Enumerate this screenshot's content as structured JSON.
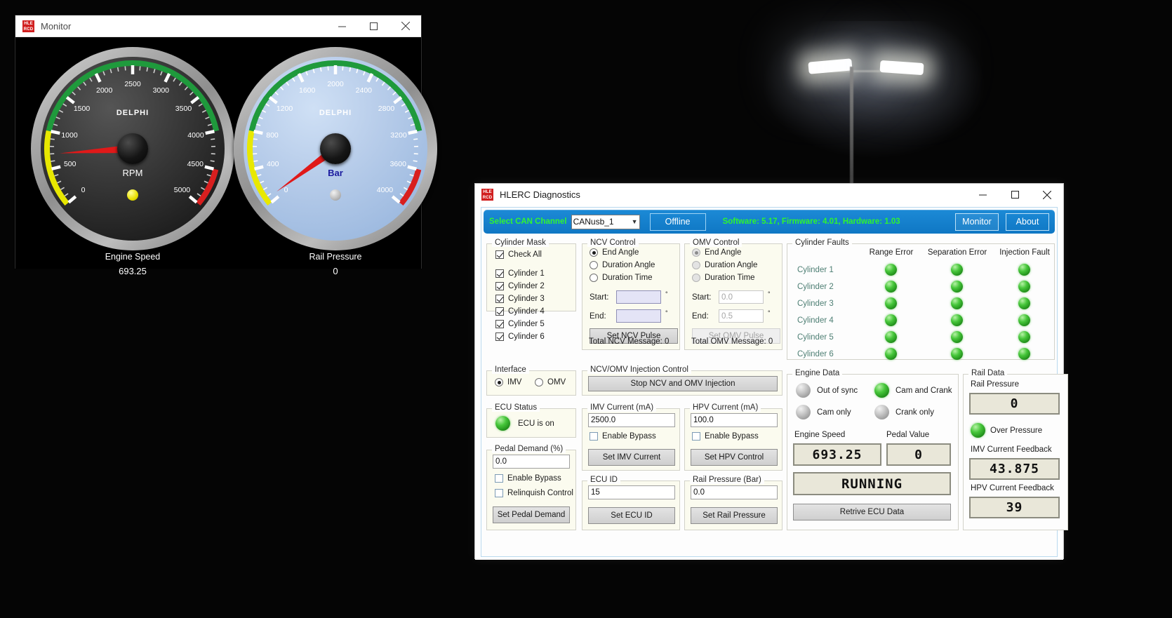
{
  "monitor_window": {
    "title": "Monitor",
    "logo_line1": "HLE",
    "logo_line2": "RCD",
    "gauges": [
      {
        "name": "Engine Speed",
        "unit": "RPM",
        "brand": "DELPHI",
        "value": "693.25",
        "ticks": [
          "0",
          "500",
          "1000",
          "1500",
          "2000",
          "2500",
          "3000",
          "3500",
          "4000",
          "4500",
          "5000"
        ],
        "min": 0,
        "max": 5000,
        "needle_value": 700,
        "zone_green": [
          1000,
          4000
        ],
        "zone_yellow": [
          0,
          1000
        ],
        "zone_red": [
          4500,
          5000
        ]
      },
      {
        "name": "Rail Pressure",
        "unit": "Bar",
        "brand": "DELPHI",
        "value": "0",
        "ticks": [
          "0",
          "400",
          "800",
          "1200",
          "1600",
          "2000",
          "2400",
          "2800",
          "3200",
          "3600",
          "4000"
        ],
        "min": 0,
        "max": 4000,
        "needle_value": 60,
        "zone_green": [
          800,
          3200
        ],
        "zone_yellow": [
          0,
          800
        ],
        "zone_red": [
          3600,
          4000
        ]
      }
    ]
  },
  "diagnostics_window": {
    "title": "HLERC Diagnostics",
    "toolbar": {
      "select_can_label": "Select CAN Channel",
      "channel_value": "CANusb_1",
      "offline_button": "Offline",
      "version_text": "Software: 5.17, Firmware: 4.01, Hardware: 1.03",
      "tab_monitor": "Monitor",
      "tab_about": "About"
    },
    "cylinder_mask": {
      "title": "Cylinder Mask",
      "check_all": "Check All",
      "check_all_checked": true,
      "items": [
        {
          "label": "Cylinder 1",
          "checked": true
        },
        {
          "label": "Cylinder 2",
          "checked": true
        },
        {
          "label": "Cylinder 3",
          "checked": true
        },
        {
          "label": "Cylinder 4",
          "checked": true
        },
        {
          "label": "Cylinder 5",
          "checked": true
        },
        {
          "label": "Cylinder 6",
          "checked": true
        }
      ]
    },
    "ncv_control": {
      "title": "NCV Control",
      "modes": [
        {
          "label": "End Angle",
          "selected": true
        },
        {
          "label": "Duration Angle",
          "selected": false
        },
        {
          "label": "Duration Time",
          "selected": false
        }
      ],
      "start_label": "Start:",
      "start_value": "",
      "end_label": "End:",
      "end_value": "",
      "degree_symbol": "°",
      "set_button": "Set NCV Pulse",
      "total_message": "Total NCV Message: 0"
    },
    "omv_control": {
      "title": "OMV Control",
      "modes": [
        {
          "label": "End Angle",
          "selected": true
        },
        {
          "label": "Duration Angle",
          "selected": false
        },
        {
          "label": "Duration Time",
          "selected": false
        }
      ],
      "start_label": "Start:",
      "start_value": "0.0",
      "end_label": "End:",
      "end_value": "0.5",
      "degree_symbol": "°",
      "set_button": "Set OMV Pulse",
      "total_message": "Total OMV Message: 0"
    },
    "cylinder_faults": {
      "title": "Cylinder Faults",
      "columns": [
        "Range Error",
        "Separation Error",
        "Injection Fault"
      ],
      "rows": [
        {
          "label": "Cylinder 1",
          "states": [
            "green",
            "green",
            "green"
          ]
        },
        {
          "label": "Cylinder 2",
          "states": [
            "green",
            "green",
            "green"
          ]
        },
        {
          "label": "Cylinder 3",
          "states": [
            "green",
            "green",
            "green"
          ]
        },
        {
          "label": "Cylinder 4",
          "states": [
            "green",
            "green",
            "green"
          ]
        },
        {
          "label": "Cylinder 5",
          "states": [
            "green",
            "green",
            "green"
          ]
        },
        {
          "label": "Cylinder 6",
          "states": [
            "green",
            "green",
            "green"
          ]
        }
      ]
    },
    "interface": {
      "title": "Interface",
      "options": [
        {
          "label": "IMV",
          "selected": true
        },
        {
          "label": "OMV",
          "selected": false
        }
      ]
    },
    "injection_control": {
      "title": "NCV/OMV Injection Control",
      "stop_button": "Stop NCV and OMV Injection"
    },
    "ecu_status": {
      "title": "ECU Status",
      "led": "green",
      "text": "ECU is on"
    },
    "imv_current": {
      "title": "IMV Current (mA)",
      "value": "2500.0",
      "bypass_label": "Enable Bypass",
      "bypass_checked": false,
      "set_button": "Set IMV Current"
    },
    "hpv_current": {
      "title": "HPV Current (mA)",
      "value": "100.0",
      "bypass_label": "Enable Bypass",
      "bypass_checked": false,
      "set_button": "Set HPV Control"
    },
    "pedal_demand": {
      "title": "Pedal Demand (%)",
      "value": "0.0",
      "bypass_label": "Enable Bypass",
      "bypass_checked": false,
      "relinquish_label": "Relinquish Control",
      "relinquish_checked": false,
      "set_button": "Set Pedal Demand"
    },
    "ecu_id": {
      "title": "ECU ID",
      "value": "15",
      "set_button": "Set ECU ID"
    },
    "rail_pressure_set": {
      "title": "Rail Pressure (Bar)",
      "value": "0.0",
      "set_button": "Set Rail Pressure"
    },
    "engine_data": {
      "title": "Engine Data",
      "indicators": [
        {
          "label": "Out of sync",
          "led": "grey"
        },
        {
          "label": "Cam and Crank",
          "led": "green"
        },
        {
          "label": "Cam only",
          "led": "grey"
        },
        {
          "label": "Crank only",
          "led": "grey"
        }
      ],
      "engine_speed_label": "Engine Speed",
      "engine_speed_value": "693.25",
      "pedal_value_label": "Pedal Value",
      "pedal_value": "0",
      "status_value": "RUNNING",
      "retrieve_button": "Retrive ECU Data"
    },
    "rail_data": {
      "title": "Rail Data",
      "rail_pressure_label": "Rail Pressure",
      "rail_pressure_value": "0",
      "over_pressure_led": "green",
      "over_pressure_label": "Over Pressure",
      "imv_feedback_label": "IMV Current Feedback",
      "imv_feedback_value": "43.875",
      "hpv_feedback_label": "HPV Current Feedback",
      "hpv_feedback_value": "39"
    }
  },
  "colors": {
    "toolbar_blue": "#1280cf",
    "toolbar_green_text": "#2ef52e",
    "panel_cream": "#fbfbef",
    "led_green": "#2fae27",
    "led_grey": "#c2c2c2",
    "accent_red": "#d11f1f"
  }
}
